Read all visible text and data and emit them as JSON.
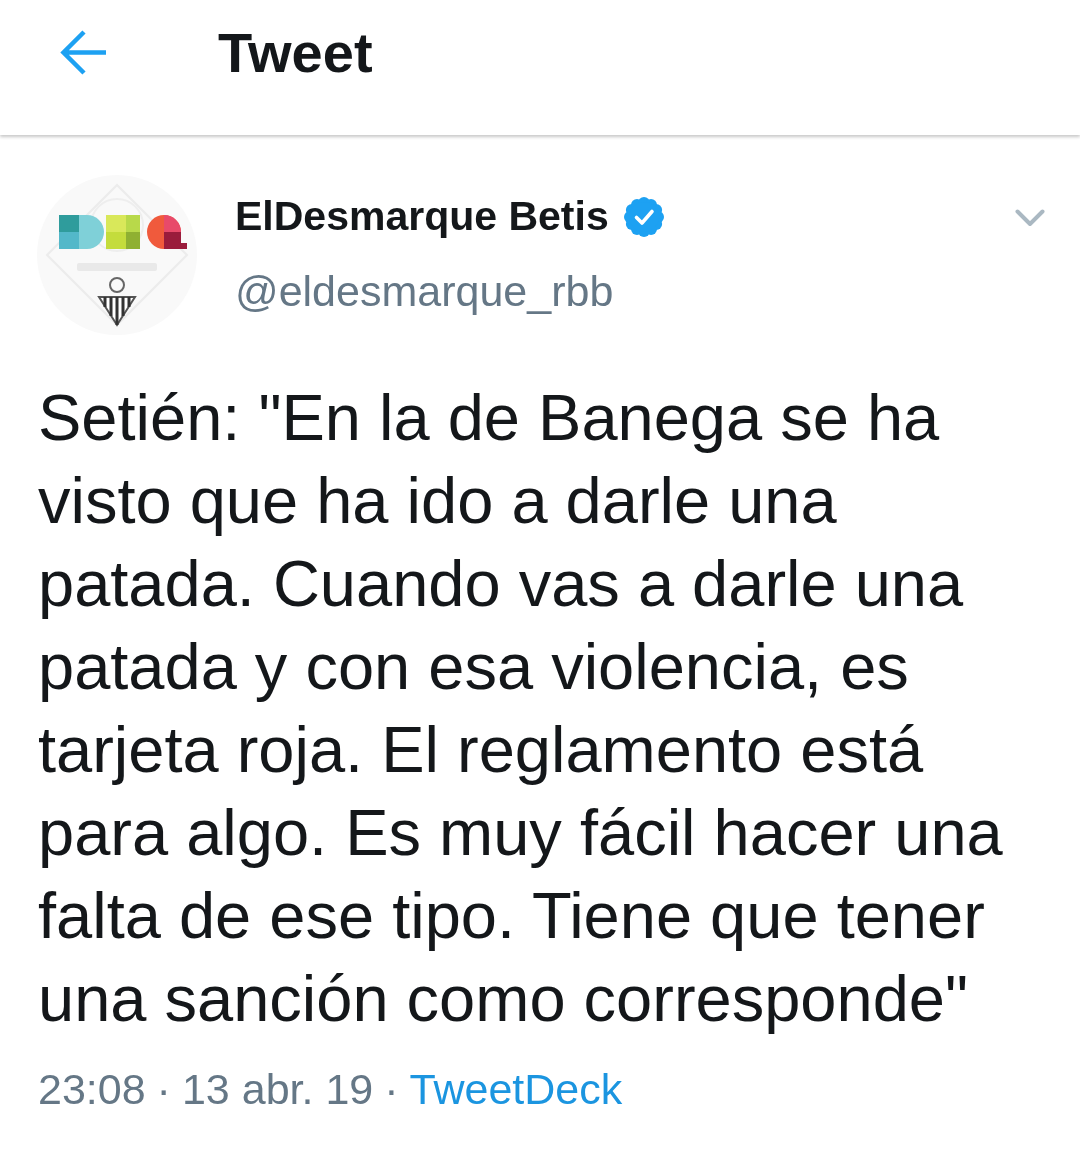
{
  "header": {
    "title": "Tweet"
  },
  "tweet": {
    "author": {
      "name": "ElDesmarque Betis",
      "verified": true,
      "handle": "@eldesmarque_rbb"
    },
    "text": "Setién: \"En la de Banega se ha visto que ha ido a darle una patada. Cuando vas a darle una patada y con esa violencia, es tarjeta roja. El reglamento está para algo. Es muy fácil hacer una falta de ese tipo. Tiene que tener una sanción como corresponde\"",
    "footer": {
      "time": "23:08",
      "separator_1": "·",
      "date": "13 abr. 19",
      "separator_2": "·",
      "source": "TweetDeck"
    }
  }
}
